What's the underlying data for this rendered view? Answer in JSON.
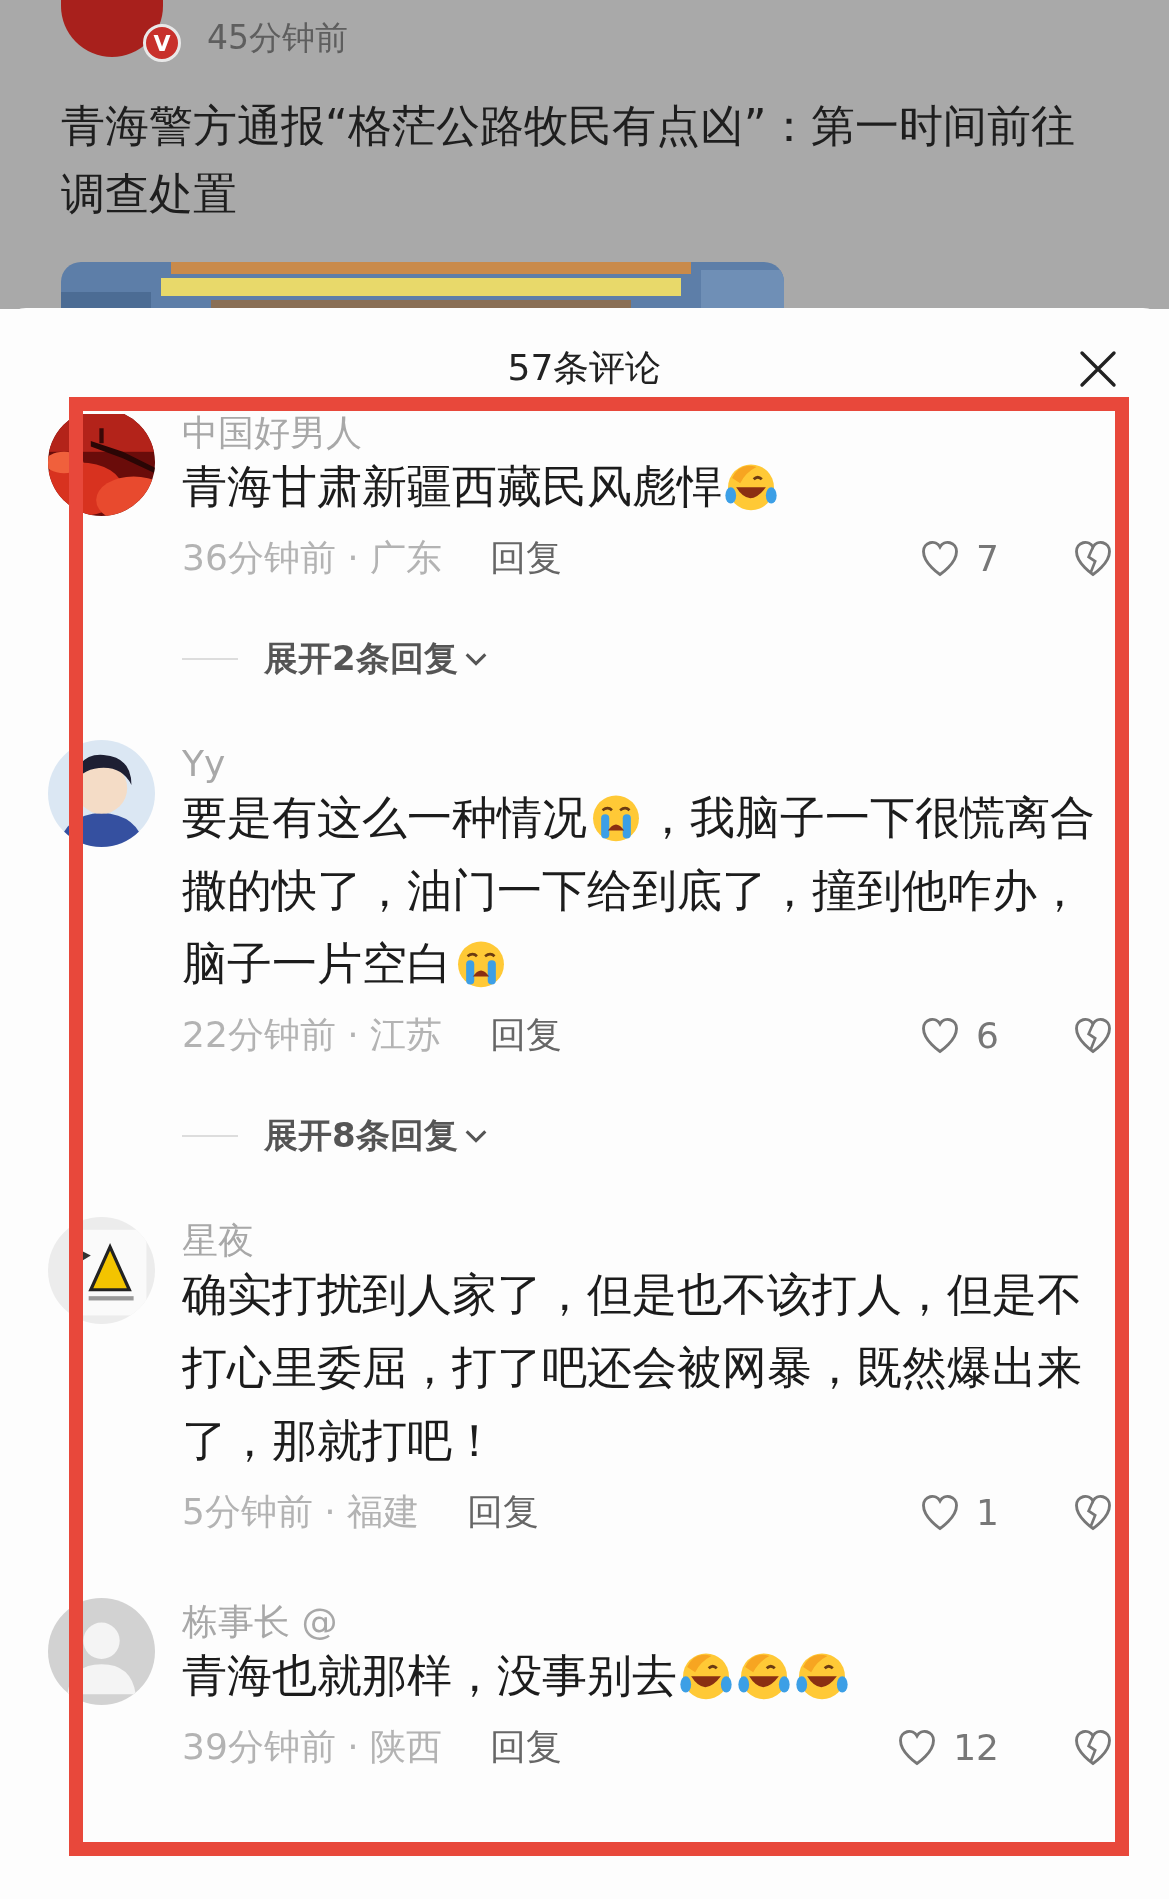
{
  "article": {
    "badge": "V",
    "time": "45分钟前",
    "title": "青海警方通报“格茫公路牧民有点凶”：第一时间前往调查处置"
  },
  "comments_panel": {
    "title": "57条评论",
    "comments": [
      {
        "avatar": {
          "kind": "landscape"
        },
        "name": "中国好男人",
        "body": [
          {
            "kind": "text",
            "text": "青海甘肃新疆西藏民风彪悍"
          },
          {
            "kind": "laugh"
          }
        ],
        "time": "36分钟前 · 广东",
        "reply": "回复",
        "likes": "7",
        "replies_toggle": "展开2条回复"
      },
      {
        "avatar": {
          "kind": "figure"
        },
        "name": "Yy",
        "body": [
          {
            "kind": "text",
            "text": "要是有这么一种情况"
          },
          {
            "kind": "cry"
          },
          {
            "kind": "text",
            "text": "，我脑子一下很慌离合"
          },
          {
            "kind": "text",
            "text": "撒的快了，油门一下给到底了，撞到他咋办，"
          },
          {
            "kind": "text",
            "text": "脑子一片空白"
          },
          {
            "kind": "cry"
          }
        ],
        "time": "22分钟前 · 江苏",
        "reply": "回复",
        "likes": "6",
        "replies_toggle": "展开8条回复"
      },
      {
        "avatar": {
          "kind": "sign"
        },
        "name": "星夜",
        "body": [
          {
            "kind": "text",
            "text": "确实打扰到人家了，但是也不该打人，但是不打心里委屈，打了吧还会被网暴，既然爆出来了，那就打吧！"
          }
        ],
        "time": "5分钟前 · 福建",
        "reply": "回复",
        "likes": "1"
      },
      {
        "avatar": {
          "kind": "default"
        },
        "name": "栋事长 @",
        "body": [
          {
            "kind": "text",
            "text": "青海也就那样，没事别去"
          },
          {
            "kind": "laugh"
          },
          {
            "kind": "laugh"
          },
          {
            "kind": "laugh"
          }
        ],
        "time": "39分钟前 · 陕西",
        "reply": "回复",
        "likes": "12"
      }
    ]
  }
}
